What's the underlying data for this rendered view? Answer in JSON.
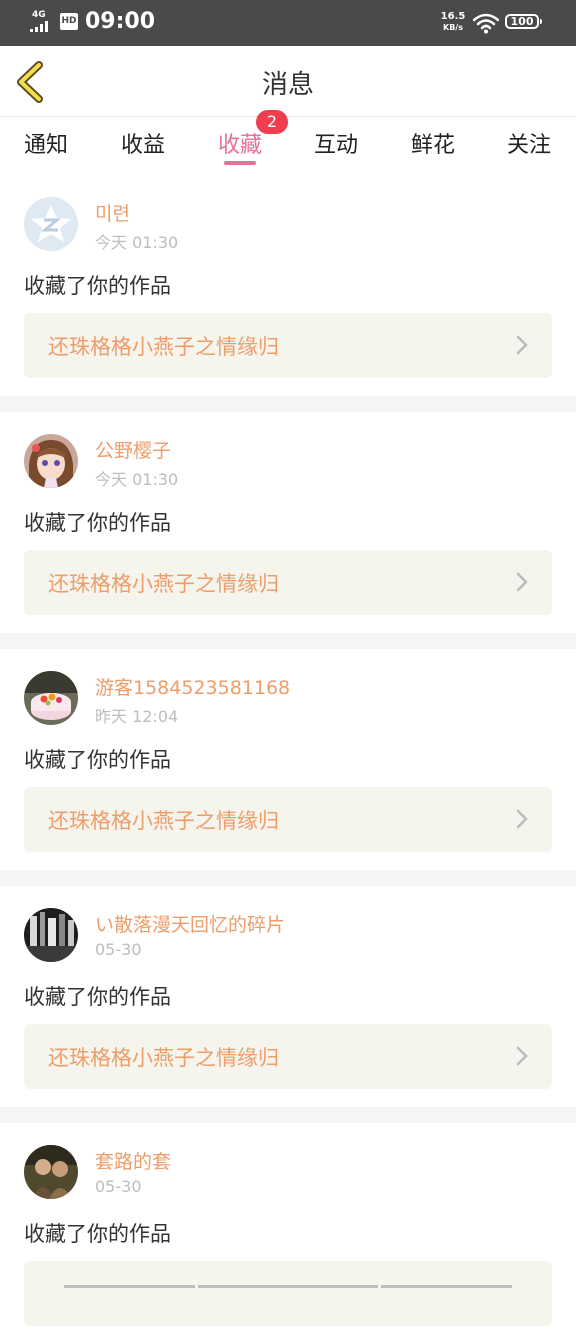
{
  "status_bar": {
    "network": "4G",
    "hd": "HD",
    "time": "09:00",
    "speed_value": "16.5",
    "speed_unit": "KB/s",
    "battery": "100"
  },
  "header": {
    "title": "消息",
    "back_icon": "chevron-left-icon"
  },
  "tabs": [
    {
      "label": "通知"
    },
    {
      "label": "收益"
    },
    {
      "label": "收藏",
      "active": true,
      "badge": "2"
    },
    {
      "label": "互动"
    },
    {
      "label": "鲜花"
    },
    {
      "label": "关注"
    }
  ],
  "colors": {
    "accent": "#e66f9b",
    "badge": "#f23d4f",
    "name_orange": "#ee9d6a",
    "card_bg": "#f5f5ee"
  },
  "feed": [
    {
      "username": "미련",
      "time": "今天 01:30",
      "action": "收藏了你的作品",
      "work_title": "还珠格格小燕子之情缘归",
      "avatar": "qzone-logo-avatar"
    },
    {
      "username": "公野樱子",
      "time": "今天 01:30",
      "action": "收藏了你的作品",
      "work_title": "还珠格格小燕子之情缘归",
      "avatar": "anime-girl-avatar"
    },
    {
      "username": "游客1584523581168",
      "time": "昨天 12:04",
      "action": "收藏了你的作品",
      "work_title": "还珠格格小燕子之情缘归",
      "avatar": "cake-avatar"
    },
    {
      "username": "い散落漫天回忆的碎片",
      "time": "05-30",
      "action": "收藏了你的作品",
      "work_title": "还珠格格小燕子之情缘归",
      "avatar": "street-photo-avatar"
    },
    {
      "username": "套路的套",
      "time": "05-30",
      "action": "收藏了你的作品",
      "work_title": "",
      "avatar": "photo-avatar"
    }
  ]
}
